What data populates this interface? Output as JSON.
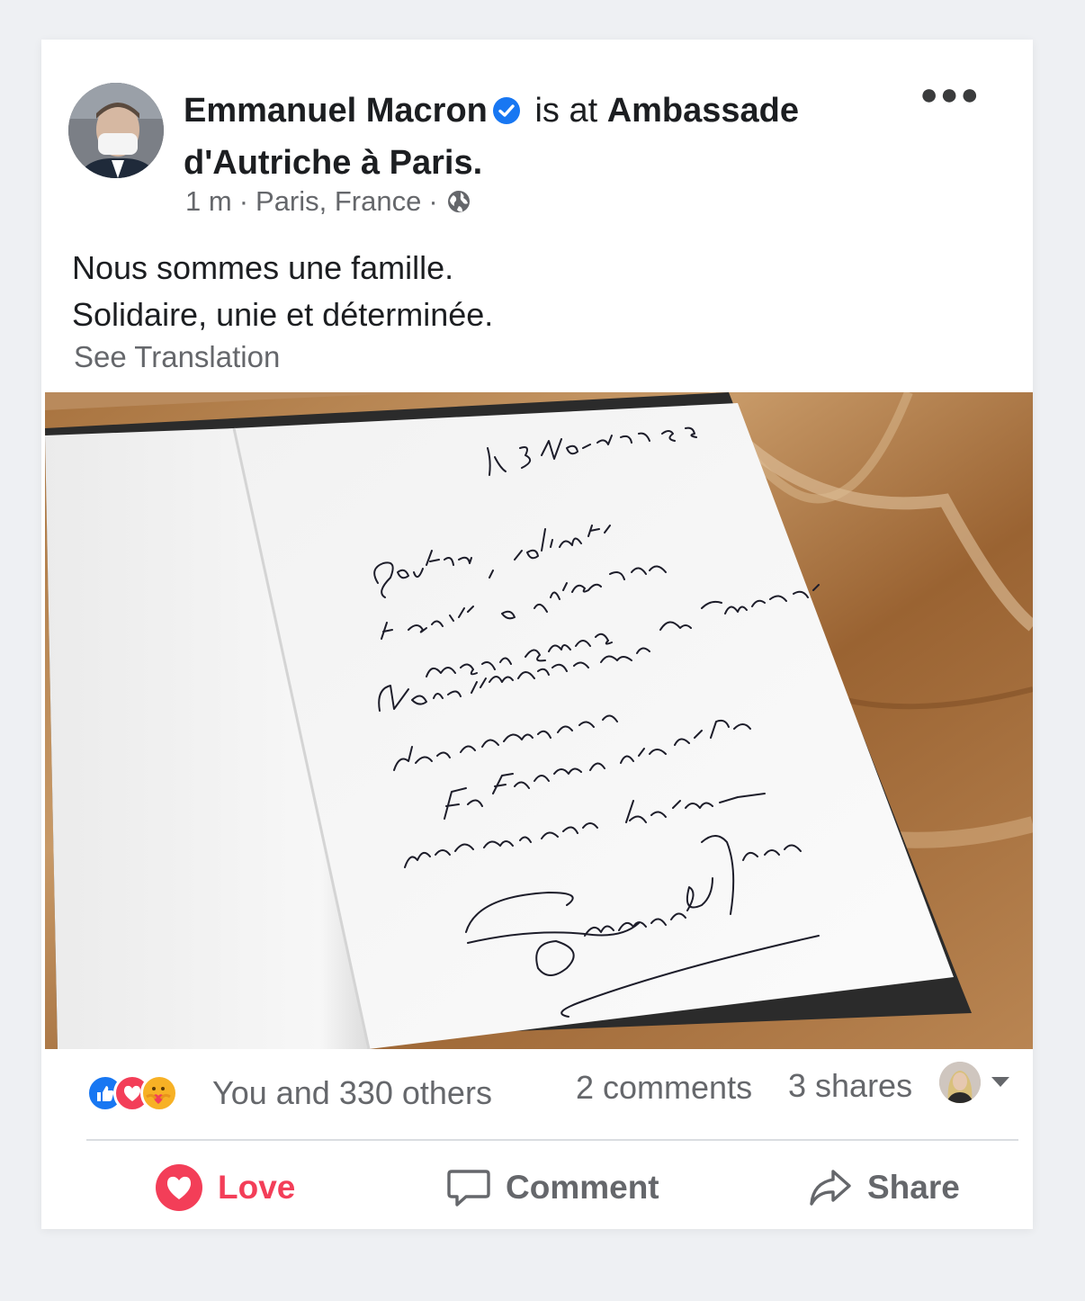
{
  "post": {
    "author": "Emmanuel Macron",
    "action_text": "is at",
    "place": "Ambassade d'Autriche à Paris.",
    "time": "1 m",
    "separator": "·",
    "location": "Paris, France",
    "privacy_icon": "globe-icon",
    "body_lines": [
      "Nous sommes une famille.",
      "Solidaire, unie et déterminée."
    ],
    "see_translation": "See Translation"
  },
  "photo": {
    "handwriting": {
      "date": "le 3 Novembre 2020",
      "lines": [
        "Soutien, solidarité",
        "et amitié à l'Autriche et",
        "au peuple autrichien.",
        "Nous tiendrons ensemble, en Européens.",
        "Nous ne cèderons rien.",
        "In Freude wie in Trauer",
        "werden wir vereint bleiben —"
      ],
      "signature": "Emmanuel Macron"
    }
  },
  "stats": {
    "reaction_icons": [
      "like-icon",
      "love-icon",
      "care-icon"
    ],
    "reactions": "You and 330 others",
    "comments": "2 comments",
    "shares": "3 shares"
  },
  "actions": {
    "love": "Love",
    "comment": "Comment",
    "share": "Share"
  },
  "colors": {
    "love": "#f33e58",
    "like": "#1877f2",
    "secondary_text": "#65676b",
    "verified": "#1877f2"
  }
}
